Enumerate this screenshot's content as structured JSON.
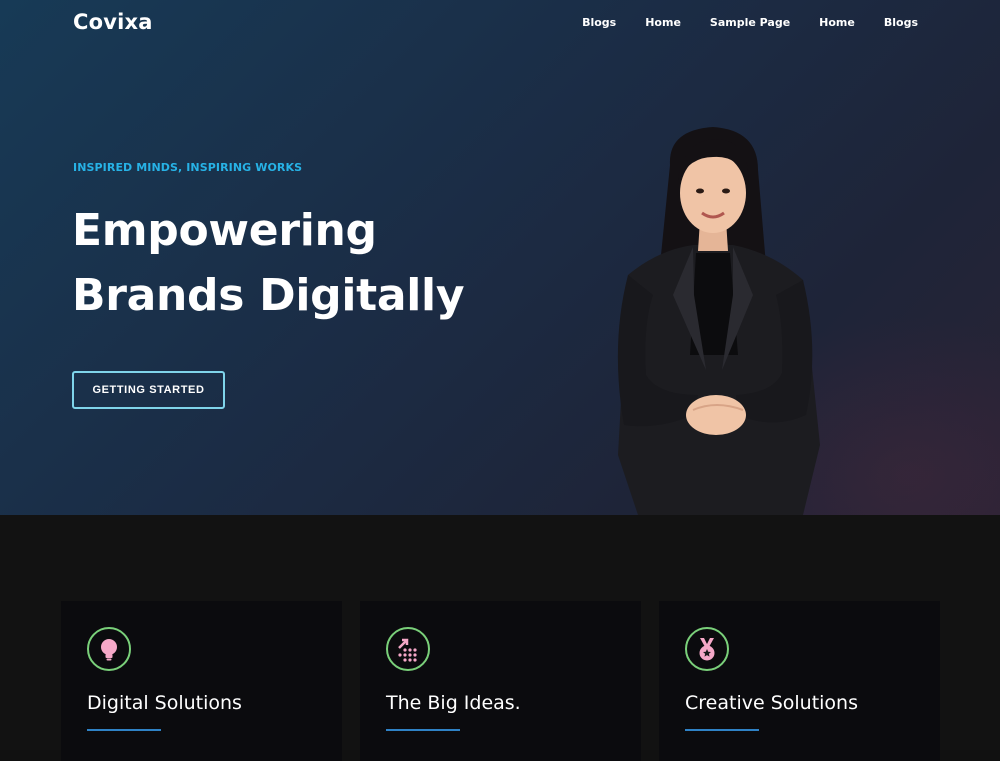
{
  "header": {
    "brand": "Covixa",
    "nav": [
      "Blogs",
      "Home",
      "Sample Page",
      "Home",
      "Blogs"
    ]
  },
  "hero": {
    "tagline": "INSPIRED MINDS, INSPIRING WORKS",
    "headline_line1": "Empowering",
    "headline_line2": "Brands Digitally",
    "cta_label": "GETTING STARTED"
  },
  "features": [
    {
      "title": "Digital Solutions",
      "icon": "lightbulb-icon"
    },
    {
      "title": "The Big Ideas.",
      "icon": "growth-dots-icon"
    },
    {
      "title": "Creative Solutions",
      "icon": "medal-icon"
    }
  ],
  "colors": {
    "accent": "#27b2e6",
    "icon_ring": "#7ad07a",
    "icon_fill": "#f6a8c8",
    "underline": "#2f82c6"
  }
}
